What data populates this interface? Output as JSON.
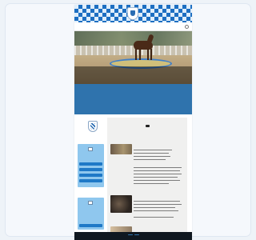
{
  "nav": {
    "items": [
      "",
      "",
      "",
      "",
      "",
      "",
      "",
      ""
    ]
  },
  "hero": {
    "caption_line1": "",
    "caption_line2": ""
  },
  "band": {
    "line1": "",
    "line2": ""
  },
  "sidebar": {
    "box1_text": "",
    "box2_text": ""
  },
  "news": [
    {
      "title": "",
      "text": ""
    },
    {
      "title": "",
      "text": ""
    }
  ],
  "cookie": {
    "text": "",
    "accept_label": "",
    "decline_label": ""
  },
  "colors": {
    "brand_blue": "#2f73ad",
    "bavarian_blue": "#1d6fc2",
    "sidebar_blue": "#8fc7ee",
    "card_background": "#f5f8fc"
  }
}
